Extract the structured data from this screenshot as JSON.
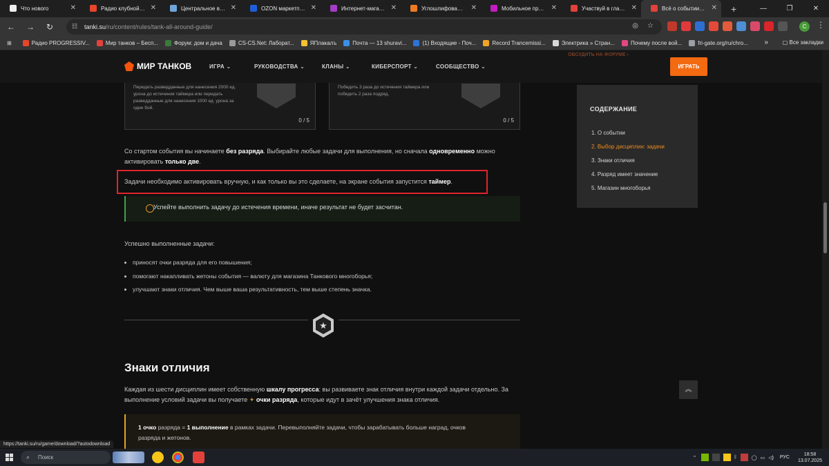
{
  "browser": {
    "tabs": [
      {
        "title": "Что нового",
        "color": "#ffffff"
      },
      {
        "title": "Радио клубной музыки",
        "color": "#e8452b"
      },
      {
        "title": "Центральное выключение",
        "color": "#6fa5dc"
      },
      {
        "title": "OZON маркетплейс",
        "color": "#1e5fd9"
      },
      {
        "title": "Интернет-магазин W",
        "color": "#a43cc5"
      },
      {
        "title": "Углошлифовальные",
        "color": "#f07a24"
      },
      {
        "title": "Мобильное прилож",
        "color": "#c21cc2"
      },
      {
        "title": "Участвуй в главном",
        "color": "#e3413a"
      },
      {
        "title": "Всё о событии «Танк",
        "color": "#e3413a"
      }
    ],
    "url_host": "tanki.su",
    "url_path": "/ru/content/rules/tank-all-around-guide/",
    "bookmarks": [
      {
        "label": "Радио PROGRESSIV...",
        "color": "#e8452b"
      },
      {
        "label": "Мир танков – Бесп...",
        "color": "#e3413a"
      },
      {
        "label": "Форум: дом и дача",
        "color": "#3b7a3b"
      },
      {
        "label": "CS-CS.Net: Лаборат...",
        "color": "#9a9a9a"
      },
      {
        "label": "ЯПлакалъ",
        "color": "#f3c133"
      },
      {
        "label": "Почта — 13 shuravi...",
        "color": "#3a8ee8"
      },
      {
        "label": "(1) Входящие - Поч...",
        "color": "#2e73d5"
      },
      {
        "label": "Record Trancemissi...",
        "color": "#f2a524"
      },
      {
        "label": "Электрика » Стран...",
        "color": "#d8d8d8"
      },
      {
        "label": "Почему после вой...",
        "color": "#e04882"
      },
      {
        "label": "fri-gate.org/ru/chro...",
        "color": "#9aa0a6"
      }
    ],
    "bookmarks_all": "Все закладки",
    "status_url": "https://tanki.su/ru/game/download/?autodownload"
  },
  "site": {
    "logo": "МИР ТАНКОВ",
    "nav": [
      "ИГРА",
      "РУКОВОДСТВА",
      "КЛАНЫ",
      "КИБЕРСПОРТ",
      "СООБЩЕСТВО"
    ],
    "play": "ИГРАТЬ",
    "forum": "ОБСУДИТЬ НА ФОРУМЕ"
  },
  "cards": [
    {
      "text": "Передать разведданные для нанесения 2000 ед. урона до истечения таймера или передать разведданные для нанесения 1000 ед. урона за один бой.",
      "count": "0 / 5"
    },
    {
      "text": "Победить 3 раза до истечения таймера или победить 2 раза подряд.",
      "count": "0 / 5"
    }
  ],
  "article": {
    "p1_a": "Со стартом события вы начинаете ",
    "p1_b": "без разряда",
    "p1_c": ". Выбирайте любые задачи для выполнения, но сначала ",
    "p1_d": "одновременно",
    "p1_e": " можно активировать ",
    "p1_f": "только две",
    "p1_g": ".",
    "p2_a": "Задачи необходимо активировать вручную, и как только вы это сделаете, на экране события запустится ",
    "p2_b": "таймер",
    "p2_c": ".",
    "notice": "Успейте выполнить задачу до истечения времени, иначе результат не будет засчитан.",
    "done_title": "Успешно выполненные задачи:",
    "bullets": [
      "приносят очки разряда для его повышения;",
      "помогают накапливать жетоны события — валюту для магазина Танкового многоборья;",
      "улучшают знаки отличия. Чем выше ваша результативность, тем выше степень значка."
    ],
    "badge_glyph": "★",
    "h2": "Знаки отличия",
    "p3_a": "Каждая из шести дисциплин имеет собственную ",
    "p3_b": "шкалу прогресса",
    "p3_c": ": вы развиваете знак отличия внутри каждой задачи отдельно. За",
    "p3_d": "выполнение условий задачи вы получаете ",
    "p3_e": "очки разряда",
    "p3_f": ", которые идут в зачёт улучшения знака отличия.",
    "tip_a": "1 очко",
    "tip_b": " разряда = ",
    "tip_c": "1 выполнение",
    "tip_d": " в рамках задачи. Перевыполняйте задачи, чтобы зарабатывать больше наград, очков",
    "tip_e": "разряда и жетонов."
  },
  "toc": {
    "title": "СОДЕРЖАНИЕ",
    "items": [
      "1. О событии",
      "2. Выбор дисциплин: задачи",
      "3. Знаки отличия",
      "4. Разряд имеет значение",
      "5. Магазин многоборья"
    ],
    "active_index": 1
  },
  "taskbar": {
    "search": "Поиск",
    "lang": "РУС",
    "time": "18:58",
    "date": "13.07.2025"
  }
}
